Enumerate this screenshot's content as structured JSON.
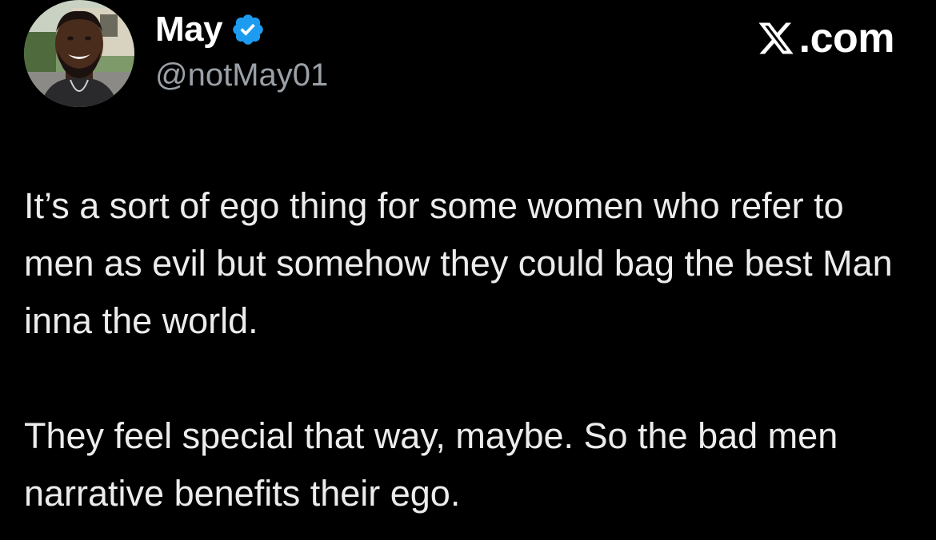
{
  "author": {
    "display_name": "May",
    "handle": "@notMay01",
    "verified": true,
    "verified_color": "#1d9bf0"
  },
  "brand": {
    "label": ".com",
    "icon": "x-logo-icon"
  },
  "tweet": {
    "paragraphs": [
      "It’s a sort of ego thing for some women who refer to men as evil but somehow they could bag the best Man inna the world.",
      "They feel special that way, maybe. So the bad men narrative benefits their ego."
    ]
  },
  "colors": {
    "background": "#000000",
    "name": "#ffffff",
    "handle": "#9aa0a6",
    "text": "#ececec"
  }
}
